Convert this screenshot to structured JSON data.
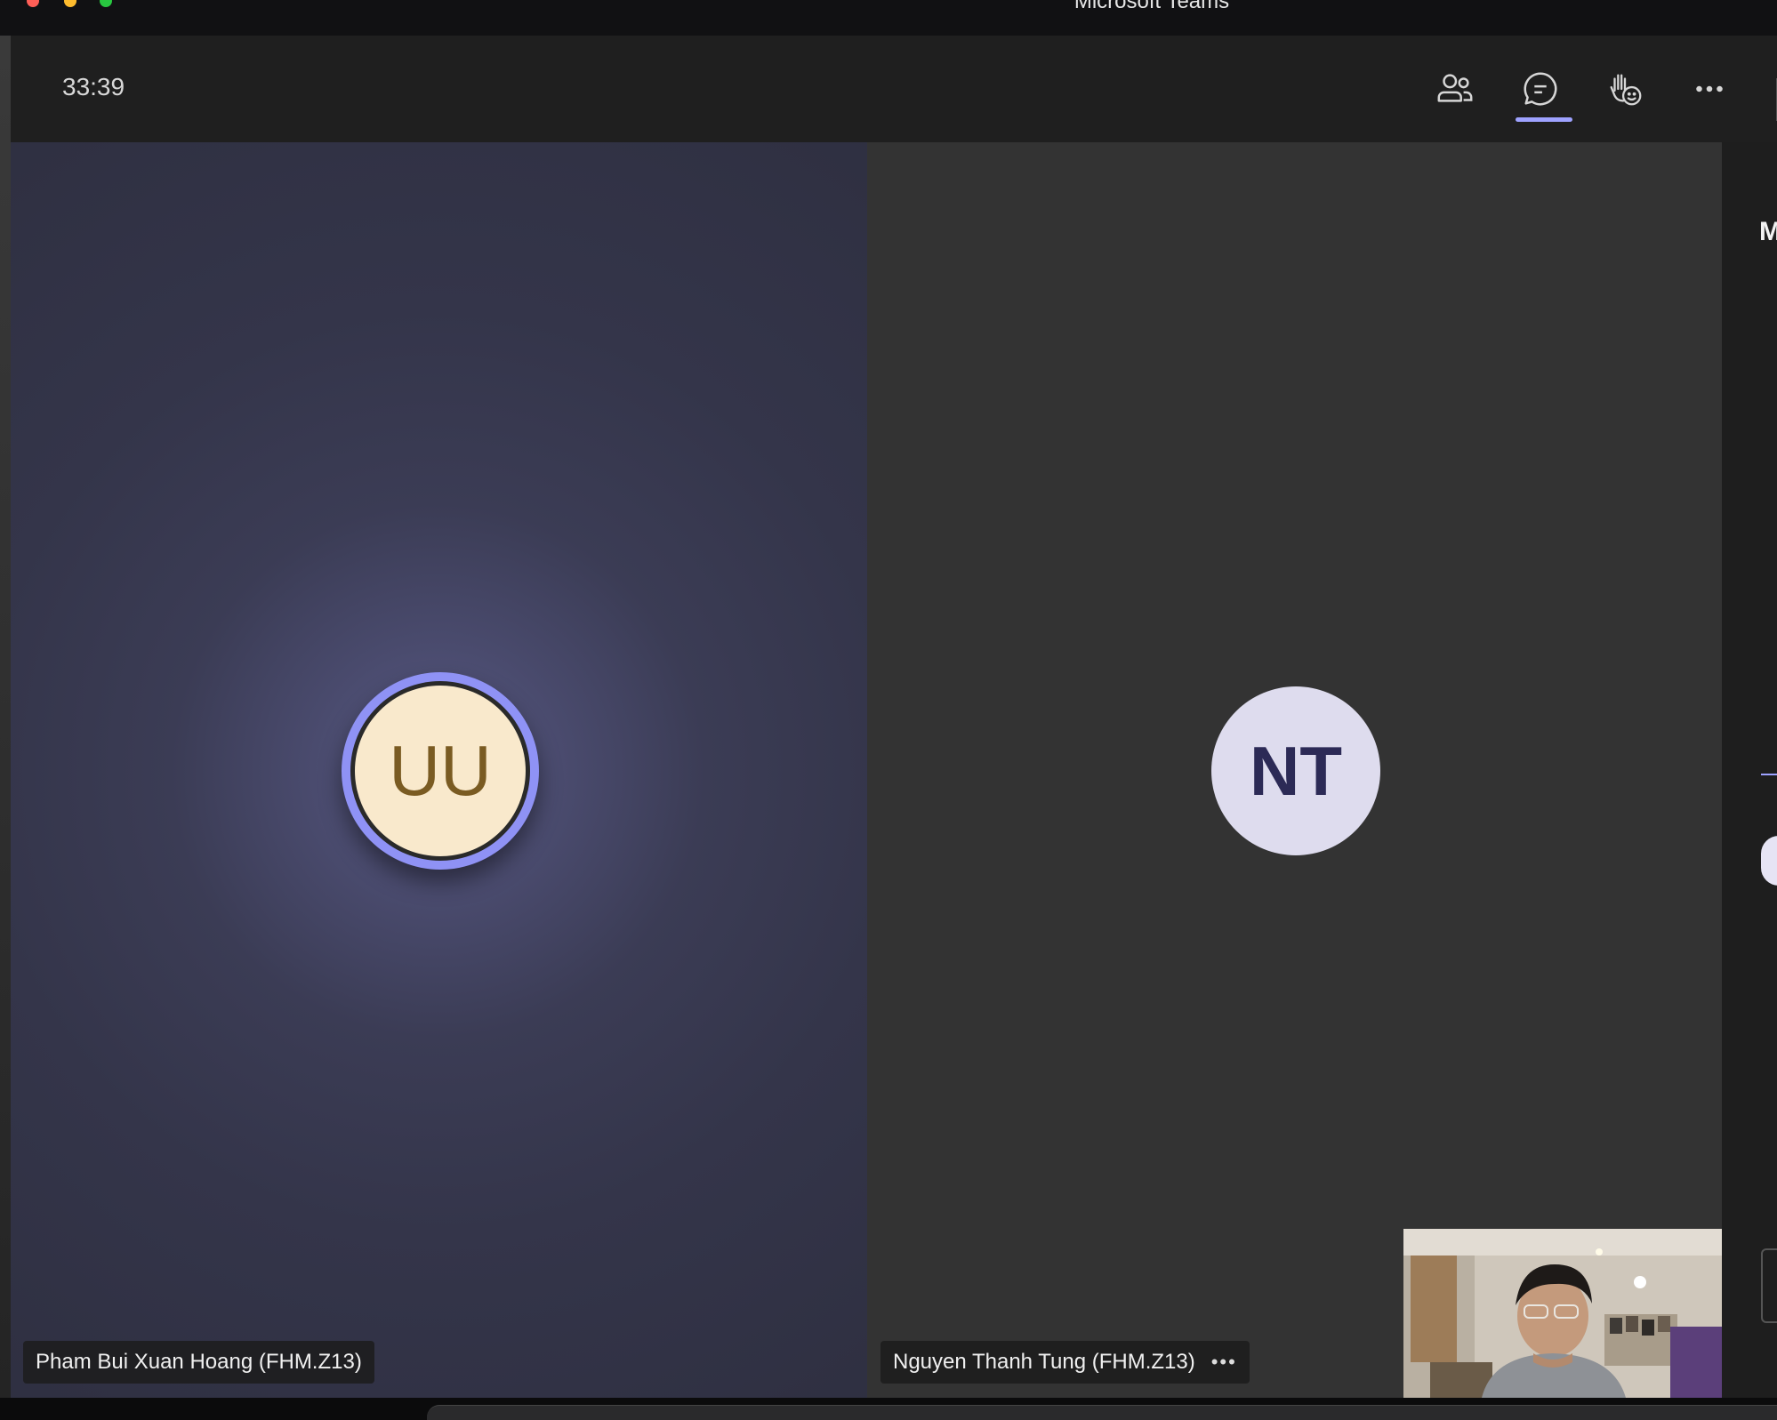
{
  "window": {
    "title": "Microsoft Teams"
  },
  "toolbar": {
    "timer": "33:39",
    "buttons": [
      {
        "name": "people",
        "icon": "people-icon"
      },
      {
        "name": "chat",
        "icon": "chat-icon",
        "active": true
      },
      {
        "name": "react",
        "icon": "raise-hand-react-icon"
      },
      {
        "name": "more",
        "icon": "more-horizontal-icon"
      }
    ]
  },
  "participants": [
    {
      "initials": "UU",
      "name": "Pham Bui Xuan Hoang (FHM.Z13)",
      "speaking": true,
      "avatar_bg": "#f9e9cc",
      "avatar_fg": "#7a5b22"
    },
    {
      "initials": "NT",
      "name": "Nguyen Thanh Tung (FHM.Z13)",
      "speaking": false,
      "avatar_bg": "#dedcee",
      "avatar_fg": "#2c2a56",
      "more_label": "•••"
    }
  ],
  "side_panel": {
    "heading_fragment": "M"
  },
  "colors": {
    "accent": "#9ea2ff",
    "speaking_ring": "#8f92f5"
  }
}
